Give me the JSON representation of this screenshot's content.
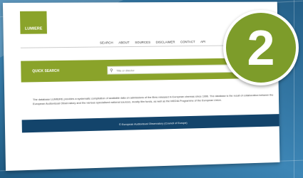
{
  "logo_text": "LUMIERE",
  "nav": {
    "items": [
      "SEARCH",
      "ABOUT",
      "SOURCES",
      "DISCLAIMER",
      "CONTACT",
      "API"
    ]
  },
  "quick_search": {
    "label": "QUICK SEARCH",
    "placeholder": "Title or director"
  },
  "description": "The database LUMIERE provides a systematic compilation of available data on admissions of the films released in European cinemas since 1996. The database is the result of collaboration between the European Audiovisual Observatory and the various specialised national sources, mostly film funds, as well as the MEDIA Programme of the European Union.",
  "footer": {
    "copyright": "© European Audiovisual Observatory (Council of Europe)"
  },
  "badge": {
    "number": "2"
  },
  "colors": {
    "accent_green": "#8aa32a",
    "footer_blue": "#13446b",
    "badge_green": "#7d9c2a"
  }
}
